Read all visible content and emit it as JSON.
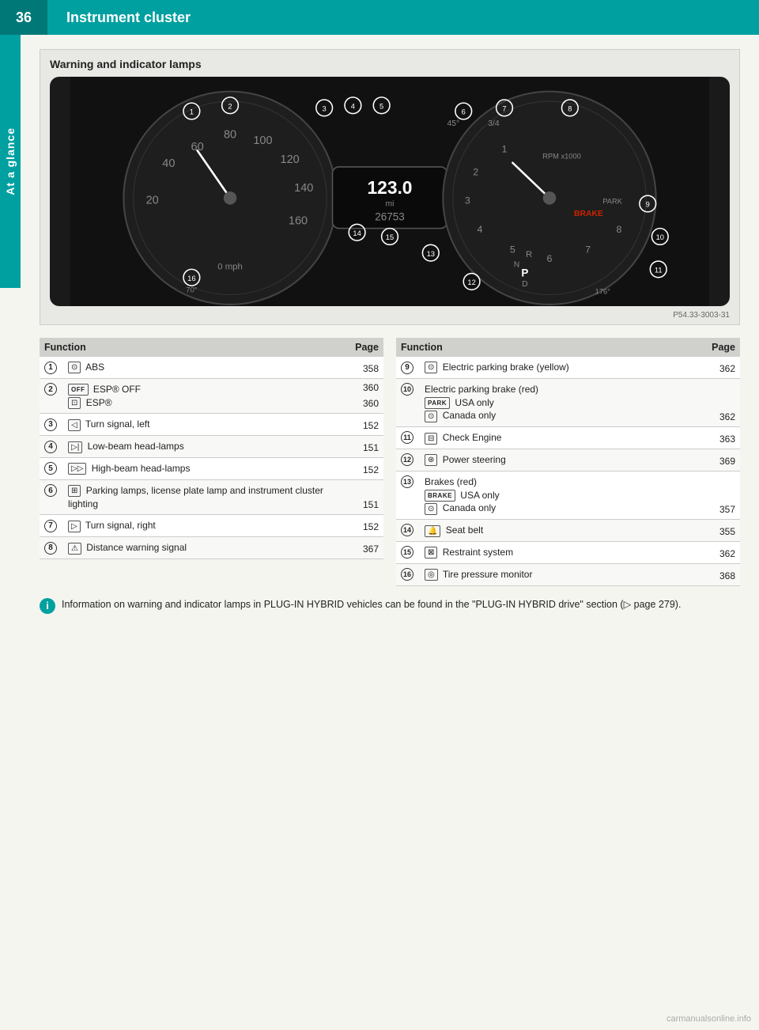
{
  "header": {
    "page_number": "36",
    "title": "Instrument cluster"
  },
  "sidebar": {
    "label": "At a glance"
  },
  "section": {
    "title": "Warning and indicator lamps",
    "image_caption": "P54.33-3003-31"
  },
  "left_table": {
    "col_function": "Function",
    "col_page": "Page",
    "rows": [
      {
        "num": "①",
        "icon": "circle-abs",
        "func": "ABS",
        "page": "358"
      },
      {
        "num": "②",
        "icon": "esp-off",
        "func": "ESP® OFF",
        "page": "360",
        "extra": {
          "icon": "esp",
          "func2": "ESP®",
          "page2": "360"
        }
      },
      {
        "num": "③",
        "icon": "turn-left",
        "func": "Turn signal, left",
        "page": "152"
      },
      {
        "num": "④",
        "icon": "low-beam",
        "func": "Low-beam head-lamps",
        "page": "151"
      },
      {
        "num": "⑤",
        "icon": "high-beam",
        "func": "High-beam head-lamps",
        "page": "152"
      },
      {
        "num": "⑥",
        "icon": "parking-lamp",
        "func": "Parking lamps, license plate lamp and instrument cluster lighting",
        "page": "151"
      },
      {
        "num": "⑦",
        "icon": "turn-right",
        "func": "Turn signal, right",
        "page": "152"
      },
      {
        "num": "⑧",
        "icon": "distance-warn",
        "func": "Distance warning signal",
        "page": "367"
      }
    ]
  },
  "right_table": {
    "col_function": "Function",
    "col_page": "Page",
    "rows": [
      {
        "num": "⑨",
        "icon": "epb-yellow",
        "func": "Electric parking brake (yellow)",
        "page": "362"
      },
      {
        "num": "⑩",
        "icon": "epb-red",
        "func": "Electric parking brake (red)",
        "page": "362",
        "sub1_icon": "park-badge",
        "sub1_text": "USA only",
        "sub2_icon": "epb-circle",
        "sub2_text": "Canada only"
      },
      {
        "num": "⑪",
        "icon": "check-engine",
        "func": "Check Engine",
        "page": "363"
      },
      {
        "num": "⑫",
        "icon": "power-steering",
        "func": "Power steering",
        "page": "369"
      },
      {
        "num": "⑬",
        "icon": "brakes-red",
        "func": "Brakes (red)",
        "page": "357",
        "sub1_icon": "brake-badge",
        "sub1_text": "USA only",
        "sub2_icon": "brake-circle",
        "sub2_text": "Canada only"
      },
      {
        "num": "⑭",
        "icon": "seat-belt",
        "func": "Seat belt",
        "page": "355"
      },
      {
        "num": "⑮",
        "icon": "restraint",
        "func": "Restraint system",
        "page": "362"
      },
      {
        "num": "⑯",
        "icon": "tire-pressure",
        "func": "Tire pressure monitor",
        "page": "368"
      }
    ]
  },
  "note": {
    "text": "Information on warning and indicator lamps in PLUG-IN HYBRID vehicles can be found in the \"PLUG-IN HYBRID drive\" section (▷ page 279)."
  }
}
